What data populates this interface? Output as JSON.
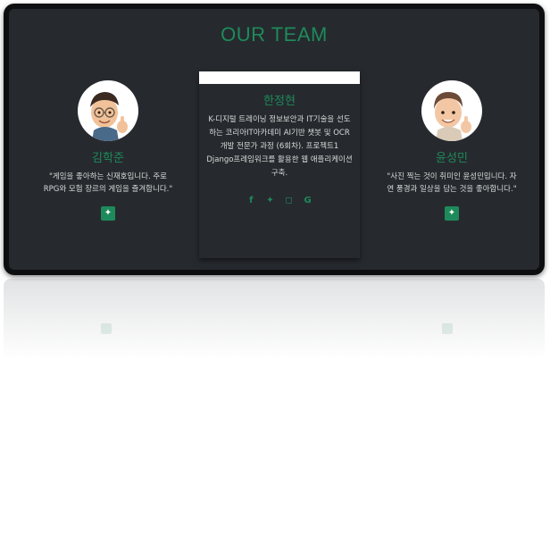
{
  "section_title": "OUR TEAM",
  "colors": {
    "accent": "#1e8a5b",
    "panel": "#262a2e",
    "frame": "#0d0e10"
  },
  "members": [
    {
      "name": "김학준",
      "quote": "\"게임을 좋아하는 신재호입니다. 주로 RPG와 모험 장르의 게임을 즐겨합니다.\"",
      "button_icon": "plus-icon",
      "button_glyph": "✦"
    },
    {
      "name": "한정현",
      "description": "K-디지털 트레이닝 정보보안과 IT기술을 선도하는 코리아IT아카데미 AI기반 챗봇 및 OCR 개발 전문가 과정 (6회차). 프로젝트1 Django프레임워크를 활용한 웹 애플리케이션 구축.",
      "socials": [
        {
          "icon": "facebook-icon",
          "glyph": "f"
        },
        {
          "icon": "twitter-icon",
          "glyph": "✦"
        },
        {
          "icon": "instagram-icon",
          "glyph": "◻"
        },
        {
          "icon": "google-icon",
          "glyph": "G"
        }
      ]
    },
    {
      "name": "윤성민",
      "quote": "\"사진 찍는 것이 취미인 윤성민입니다. 자연 풍경과 일상을 담는 것을 좋아합니다.\"",
      "button_icon": "plus-icon",
      "button_glyph": "✦"
    }
  ]
}
